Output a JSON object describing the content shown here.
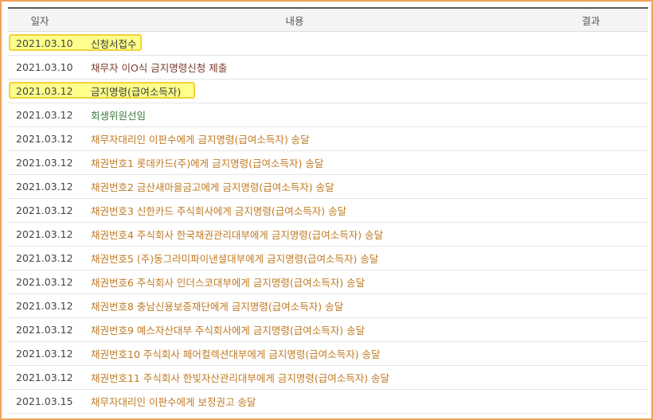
{
  "table": {
    "headers": {
      "date": "일자",
      "content": "내용",
      "result": "결과"
    },
    "rows": [
      {
        "date": "2021.03.10",
        "content": "신청서접수",
        "color": "#3a3a3a",
        "highlight": true
      },
      {
        "date": "2021.03.10",
        "content": "채무자 이O식 금지명령신청 제출",
        "color": "#7a3a2a",
        "highlight": false
      },
      {
        "date": "2021.03.12",
        "content": "금지명령(급여소득자)",
        "color": "#3a3a3a",
        "highlight": true
      },
      {
        "date": "2021.03.12",
        "content": "회생위원선임",
        "color": "#3a7a3a",
        "highlight": false
      },
      {
        "date": "2021.03.12",
        "content": "채무자대리인 이판수에게 금지명령(급여소득자) 송달",
        "color": "#c07a22",
        "highlight": false
      },
      {
        "date": "2021.03.12",
        "content": "채권번호1 롯데카드(주)에게 금지명령(급여소득자) 송달",
        "color": "#c07a22",
        "highlight": false
      },
      {
        "date": "2021.03.12",
        "content": "채권번호2 금산새마을금고에게 금지명령(급여소득자) 송달",
        "color": "#c07a22",
        "highlight": false
      },
      {
        "date": "2021.03.12",
        "content": "채권번호3 신한카드 주식회사에게 금지명령(급여소득자) 송달",
        "color": "#c07a22",
        "highlight": false
      },
      {
        "date": "2021.03.12",
        "content": "채권번호4 주식회사 한국채권관리대부에게 금지명령(급여소득자) 송달",
        "color": "#c07a22",
        "highlight": false
      },
      {
        "date": "2021.03.12",
        "content": "채권번호5 (주)동그라미파이낸셜대부에게 금지명령(급여소득자) 송달",
        "color": "#c07a22",
        "highlight": false
      },
      {
        "date": "2021.03.12",
        "content": "채권번호6 주식회사 인더스코대부에게 금지명령(급여소득자) 송달",
        "color": "#c07a22",
        "highlight": false
      },
      {
        "date": "2021.03.12",
        "content": "채권번호8 충남신용보증재단에게 금지명령(급여소득자) 송달",
        "color": "#c07a22",
        "highlight": false
      },
      {
        "date": "2021.03.12",
        "content": "채권번호9 예스자산대부 주식회사에게 금지명령(급여소득자) 송달",
        "color": "#c07a22",
        "highlight": false
      },
      {
        "date": "2021.03.12",
        "content": "채권번호10 주식회사 페어컬렉션대부에게 금지명령(급여소득자) 송달",
        "color": "#c07a22",
        "highlight": false
      },
      {
        "date": "2021.03.12",
        "content": "채권번호11 주식회사 한빛자산관리대부에게 금지명령(급여소득자) 송달",
        "color": "#c07a22",
        "highlight": false
      },
      {
        "date": "2021.03.15",
        "content": "채무자대리인 이판수에게 보정권고 송달",
        "color": "#c07a22",
        "highlight": false
      }
    ]
  }
}
